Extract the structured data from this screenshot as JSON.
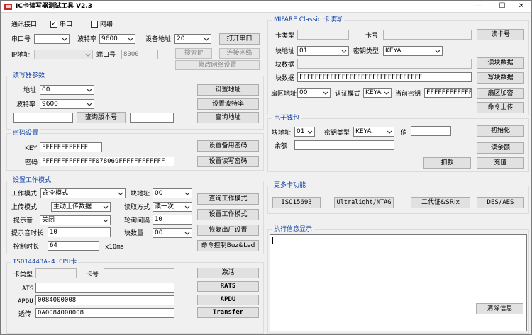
{
  "window": {
    "title": "IC卡读写器测试工具 V2.3",
    "min_glyph": "—",
    "max_glyph": "☐",
    "close_glyph": "✕"
  },
  "comm": {
    "interface_label": "通讯接口",
    "serial_label": "串口",
    "serial_checked": true,
    "network_label": "网络",
    "network_checked": false,
    "port_label": "串口号",
    "port_value": "",
    "baud_label": "波特率",
    "baud_value": "9600",
    "device_addr_label": "设备地址",
    "device_addr_value": "20",
    "open_btn": "打开串口",
    "ip_label": "IP地址",
    "ip_value": "",
    "netport_label": "端口号",
    "netport_value": "8000",
    "search_ip_btn": "搜索IP",
    "connect_net_btn": "连接网络",
    "modify_net_btn": "修改网络设置"
  },
  "reader": {
    "title": "读写器参数",
    "addr_label": "地址",
    "addr_value": "00",
    "baud_label": "波特率",
    "baud_value": "9600",
    "set_addr_btn": "设置地址",
    "set_baud_btn": "设置波特率",
    "version_value": "",
    "query_version_btn": "查询版本号",
    "addr_result_value": "",
    "query_addr_btn": "查询地址"
  },
  "password": {
    "title": "密码设置",
    "key_label": "KEY",
    "key_value": "FFFFFFFFFFFF",
    "set_backup_btn": "设置备用密码",
    "pwd_label": "密码",
    "pwd_value": "FFFFFFFFFFFFFF078069FFFFFFFFFFFF",
    "set_rw_btn": "设置读写密码"
  },
  "workmode": {
    "title": "设置工作模式",
    "mode_label": "工作模式",
    "mode_value": "命令模式",
    "block_label": "块地址",
    "block_value": "00",
    "query_mode_btn": "查询工作模式",
    "upload_label": "上传模式",
    "upload_value": "主动上传数据",
    "read_way_label": "读取方式",
    "read_way_value": "读一次",
    "set_mode_btn": "设置工作模式",
    "prompt_label": "提示音",
    "prompt_value": "关闭",
    "poll_label": "轮询间隔",
    "poll_value": "10",
    "restore_btn": "恢复出厂设置",
    "prompt_len_label": "提示音时长",
    "prompt_len_value": "10",
    "block_count_label": "块数量",
    "block_count_value": "00",
    "cmd_ctrl_btn": "命令控制Buz&Led",
    "ctrl_time_label": "控制时长",
    "ctrl_time_value": "64",
    "ctrl_time_unit": "x10ms"
  },
  "cpu": {
    "title": "ISO14443A-4 CPU卡",
    "card_type_label": "卡类型",
    "card_type_value": "",
    "card_no_label": "卡号",
    "card_no_value": "",
    "activate_btn": "激活",
    "ats_label": "ATS",
    "ats_value": "",
    "rats_btn": "RATS",
    "apdu_label": "APDU",
    "apdu_value": "0084000008",
    "apdu_btn": "APDU",
    "transfer_label": "透传",
    "transfer_value": "0A0084000008",
    "transfer_btn": "Transfer"
  },
  "mifare": {
    "title": "MIFARE Classic 卡读写",
    "card_type_label": "卡类型",
    "card_type_value": "",
    "card_no_label": "卡号",
    "card_no_value": "",
    "read_card_btn": "读卡号",
    "block_label": "块地址",
    "block_value": "01",
    "key_type_label": "密钥类型",
    "key_type_value": "KEYA",
    "block_data_label": "块数据",
    "block_data_value": "",
    "read_block_btn": "读块数据",
    "block_data2_label": "块数据",
    "block_data2_value": "FFFFFFFFFFFFFFFFFFFFFFFFFFFFFFFF",
    "write_block_btn": "写块数据",
    "sector_label": "扇区地址",
    "sector_value": "00",
    "auth_label": "认证模式",
    "auth_value": "KEYA",
    "cur_key_label": "当前密钥",
    "cur_key_value": "FFFFFFFFFFFF",
    "sector_encrypt_btn": "扇区加密",
    "cmd_upload_btn": "命令上传"
  },
  "wallet": {
    "title": "电子钱包",
    "block_label": "块地址",
    "block_value": "01",
    "key_type_label": "密钥类型",
    "key_type_value": "KEYA",
    "value_label": "值",
    "value_value": "",
    "init_btn": "初始化",
    "balance_label": "余额",
    "balance_value": "",
    "read_balance_btn": "读余额",
    "deduct_btn": "扣款",
    "recharge_btn": "充值"
  },
  "multicard": {
    "title": "更多卡功能",
    "btn1": "ISO15693",
    "btn2": "Ultralight/NTAG",
    "btn3": "二代证&SRIx",
    "btn4": "DES/AES"
  },
  "log": {
    "title": "执行信息显示",
    "content": "",
    "clear_btn": "清除信息"
  }
}
